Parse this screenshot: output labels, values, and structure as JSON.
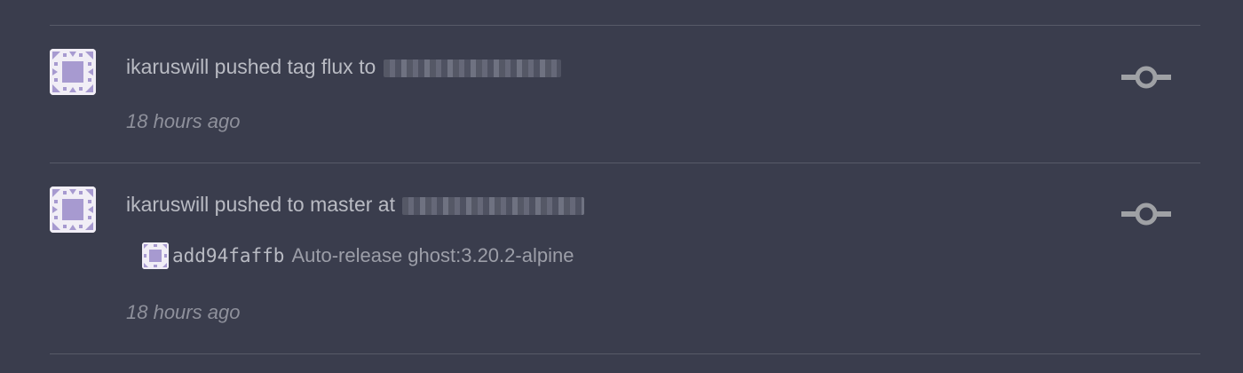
{
  "events": [
    {
      "text": "ikaruswill pushed tag flux to",
      "time": "18 hours ago"
    },
    {
      "text": "ikaruswill pushed to master at",
      "time": "18 hours ago",
      "commit": {
        "sha": "add94faffb",
        "message": "Auto-release ghost:3.20.2-alpine"
      }
    }
  ],
  "icons": {
    "avatar": "identicon-avatar",
    "event_type": "git-commit-icon"
  },
  "colors": {
    "background": "#3a3d4d",
    "text": "#b9bbc3",
    "muted": "#8e909b",
    "icon": "#9fa1a5",
    "avatar_accent": "#a79ad0"
  }
}
